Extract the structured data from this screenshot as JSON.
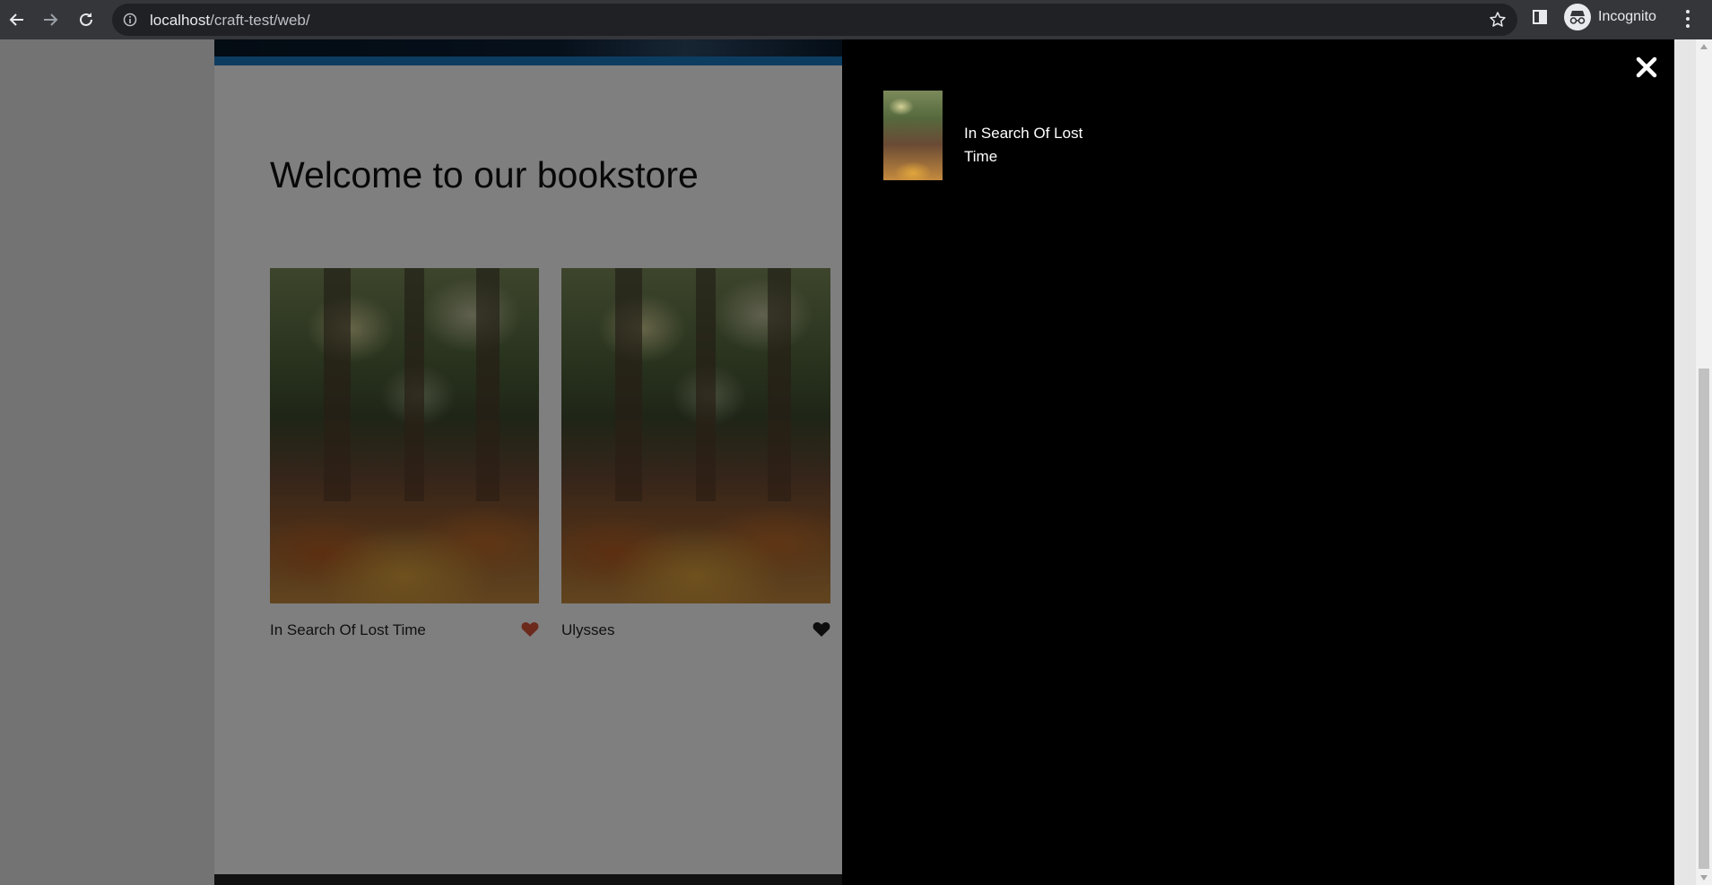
{
  "browser": {
    "url_host": "localhost",
    "url_path": "/craft-test/web/",
    "profile_label": "Incognito",
    "icons": {
      "back": "arrow-left-icon",
      "forward": "arrow-right-icon",
      "reload": "reload-icon",
      "site_info": "info-icon",
      "bookmark": "star-icon",
      "side_panel": "side-panel-icon",
      "incognito": "incognito-icon",
      "menu": "kebab-menu-icon"
    }
  },
  "page": {
    "heading": "Welcome to our bookstore",
    "books": [
      {
        "title": "In Search Of Lost Time",
        "favorited": true,
        "heart_color": "#d9553a"
      },
      {
        "title": "Ulysses",
        "favorited": false,
        "heart_color": "#1b1b1b"
      }
    ]
  },
  "drawer": {
    "close_icon": "close-icon",
    "favorites": [
      {
        "title": "In Search Of Lost Time"
      }
    ]
  },
  "colors": {
    "drawer_bg": "#000000",
    "accent_bar": "#1a78c2"
  }
}
